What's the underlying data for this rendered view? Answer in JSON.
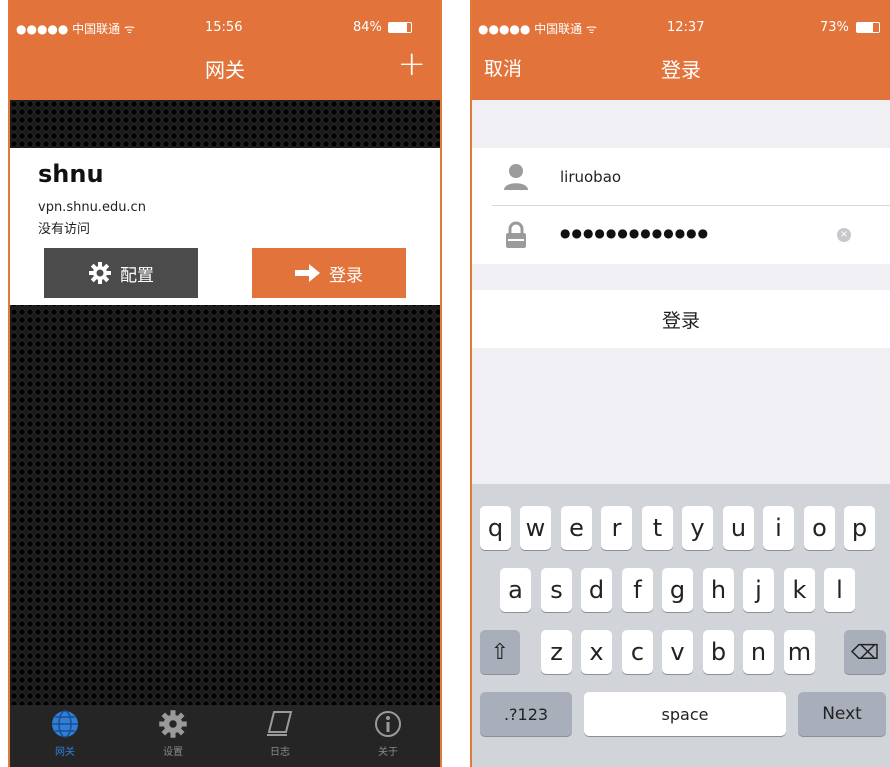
{
  "left_phone": {
    "status": {
      "signal": "●●●●● 中国联通 ᯤ",
      "time": "15:56",
      "battery": "84%"
    },
    "nav": {
      "title": "网关",
      "add_label": "+"
    },
    "gateway": {
      "name": "shnu",
      "host": "vpn.shnu.edu.cn",
      "status": "没有访问",
      "config_label": "配置",
      "login_label": "登录"
    },
    "tabs": [
      {
        "label": "网关",
        "icon": "globe-icon"
      },
      {
        "label": "设置",
        "icon": "gear-icon"
      },
      {
        "label": "日志",
        "icon": "log-icon"
      },
      {
        "label": "关于",
        "icon": "info-icon"
      }
    ]
  },
  "right_phone": {
    "status": {
      "signal": "●●●●● 中国联通 ᯤ",
      "time": "12:37",
      "battery": "73%"
    },
    "nav": {
      "cancel_label": "取消",
      "title": "登录"
    },
    "form": {
      "username_value": "liruobao",
      "password_value": "●●●●●●●●●●●●●",
      "submit_label": "登录"
    },
    "keyboard": {
      "row1": [
        "q",
        "w",
        "e",
        "r",
        "t",
        "y",
        "u",
        "i",
        "o",
        "p"
      ],
      "row2": [
        "a",
        "s",
        "d",
        "f",
        "g",
        "h",
        "j",
        "k",
        "l"
      ],
      "row3": [
        "z",
        "x",
        "c",
        "v",
        "b",
        "n",
        "m"
      ],
      "shift_glyph": "⇧",
      "delete_glyph": "⌫",
      "numbers_label": ".?123",
      "space_label": "space",
      "next_label": "Next"
    }
  },
  "colors": {
    "accent": "#e2733a",
    "config_button": "#4b4b4b",
    "tab_active": "#2f7fd8"
  }
}
